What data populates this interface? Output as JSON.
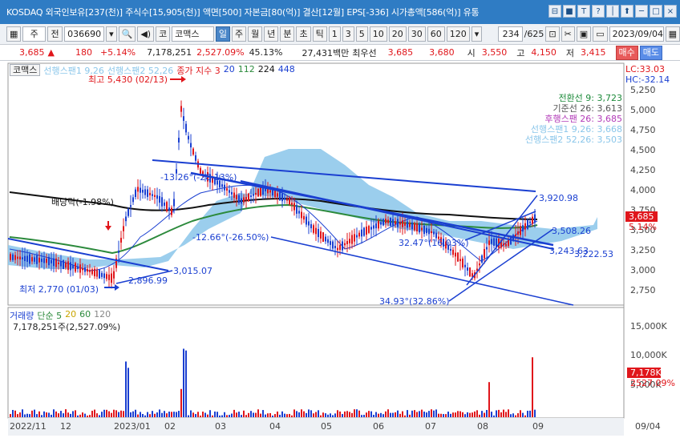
{
  "window": {
    "title": "KOSDAQ 외국인보유[237(천)] 주식수[15,905(천)] 액면[500] 자본금[80(억)] 결산[12월] EPS[-336] 시가총액[586(억)] 유통",
    "buttons": [
      "⊟",
      "■",
      "T",
      "?",
      "│",
      "⬆",
      "─",
      "□",
      "×"
    ]
  },
  "toolbar": {
    "type_code": "주",
    "mode": "전",
    "stock_code": "036690",
    "market_prefix": "코",
    "stock_name": "코맥스",
    "period_buttons": [
      "일",
      "주",
      "월",
      "년",
      "분",
      "초",
      "틱"
    ],
    "interval_buttons": [
      "1",
      "3",
      "5",
      "10",
      "20",
      "30",
      "60",
      "120"
    ],
    "page_count": "234",
    "page_total": "/625",
    "date": "2023/09/04"
  },
  "quote": {
    "price": "3,685",
    "change_arrow": "▲",
    "change": "180",
    "change_pct": "+5.14%",
    "volume": "7,178,251",
    "volume_ratio": "2,527.09%",
    "turnover": "45.13%",
    "amount": "27,431백만",
    "ask_label": "최우선",
    "ask1": "3,685",
    "bid1": "3,680",
    "open_label": "시",
    "open": "3,550",
    "high_label": "고",
    "high": "4,150",
    "low_label": "저",
    "low": "3,415",
    "buy_label": "매수",
    "sell_label": "매도"
  },
  "chart": {
    "tab": "코맥스",
    "legend_span1": "선행스팬1 9,26",
    "legend_span2": "선행스팬2 52,26",
    "legend_ma_label": "종가 지수 3",
    "legend_ma_values": [
      "20",
      "112",
      "224",
      "448"
    ],
    "lc": "LC:33.03",
    "hc": "HC:-32.14",
    "ichimoku": [
      {
        "label": "전환선 9: 3,723",
        "color": "#1c8a3a"
      },
      {
        "label": "기준선 26: 3,613",
        "color": "#555555"
      },
      {
        "label": "후행스팬 26: 3,685",
        "color": "#b23ab8"
      },
      {
        "label": "선행스팬1 9,26: 3,668",
        "color": "#8ac6ea"
      },
      {
        "label": "선행스팬2 52,26: 3,503",
        "color": "#8ac6ea"
      }
    ],
    "y_ticks": [
      "5,250",
      "5,000",
      "4,750",
      "4,500",
      "4,250",
      "4,000",
      "3,750",
      "3,500",
      "3,250",
      "3,000",
      "2,750"
    ],
    "current_price": "3,685",
    "current_pct": "5.14%",
    "annotations": {
      "high": "최고 5,430 (02/13)",
      "low": "최저 2,770 (01/03)",
      "dividend": "배당락(-1.98%)",
      "t1": "-13.26°(-28.13%)",
      "t2": "-12.66°(-26.50%)",
      "t3": "32.47°(16.03%)",
      "t4": "34.93°(32.86%)",
      "p1": "3,920.98",
      "p2": "3,508.26",
      "p3": "3,243.63",
      "p4": "3,222.53",
      "p5": "3,015.07",
      "p6": "2,896.99"
    },
    "x_labels": [
      "2022/11",
      "12",
      "2023/01",
      "02",
      "03",
      "04",
      "05",
      "06",
      "07",
      "08",
      "09",
      "09/04"
    ]
  },
  "volume": {
    "title": "거래량",
    "ma_label": "단순 5",
    "ma_values": [
      "20",
      "60",
      "120"
    ],
    "value_text": "7,178,251주(2,527.09%)",
    "y_ticks": [
      "15,000K",
      "10,000K",
      "5,000K"
    ],
    "current": "7,178K",
    "current_pct": "2527.09%"
  }
}
